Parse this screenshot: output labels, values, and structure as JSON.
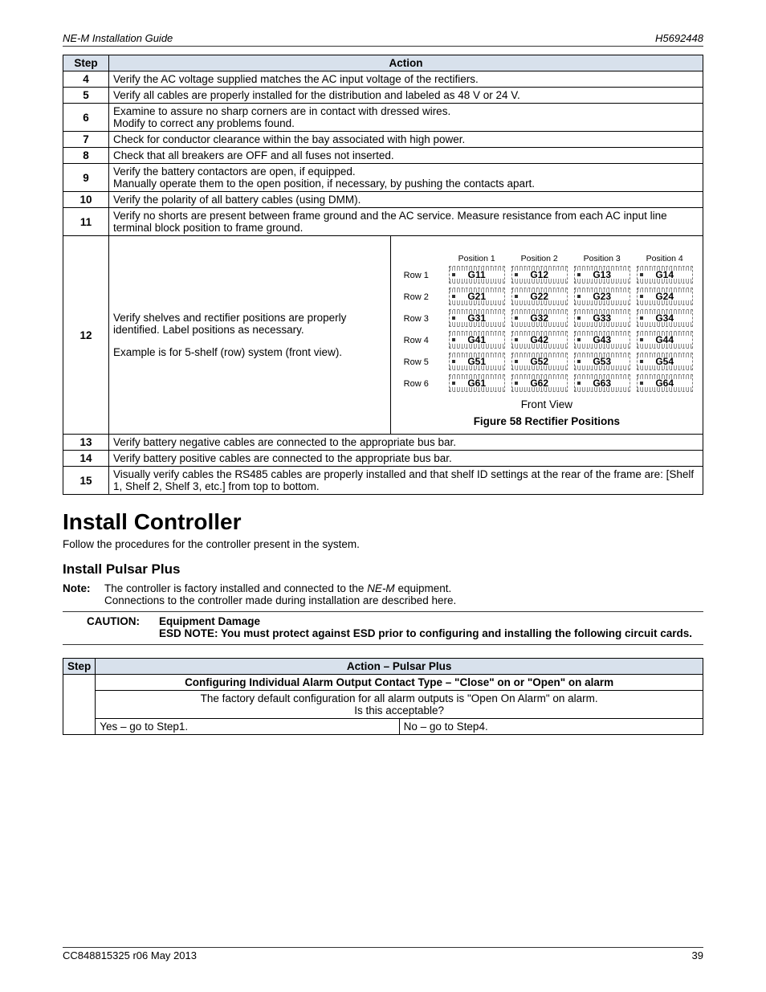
{
  "header": {
    "left": "NE-M Installation Guide",
    "right": "H5692448"
  },
  "footer": {
    "left": "CC848815325  r06  May 2013",
    "right": "39"
  },
  "table1": {
    "headers": {
      "step": "Step",
      "action": "Action"
    },
    "rows": [
      {
        "step": "4",
        "action": "Verify the AC voltage supplied matches the AC input voltage of the rectifiers."
      },
      {
        "step": "5",
        "action": "Verify all cables are properly installed for the distribution and labeled as 48 V or 24 V."
      },
      {
        "step": "6",
        "action": "Examine to assure no sharp corners are in contact with dressed wires.\nModify to correct any problems found."
      },
      {
        "step": "7",
        "action": "Check for conductor clearance within the bay associated with high power."
      },
      {
        "step": "8",
        "action": "Check that all breakers are OFF and all fuses not inserted."
      },
      {
        "step": "9",
        "action": "Verify the battery contactors are open, if equipped.\nManually operate them to the open position, if necessary, by pushing the contacts apart."
      },
      {
        "step": "10",
        "action": "Verify the polarity of all battery cables (using DMM)."
      },
      {
        "step": "11",
        "action": "Verify no shorts are present between frame ground and the AC service. Measure resistance from each AC input line terminal block position to frame ground."
      },
      {
        "step": "12",
        "action_left": "Verify shelves and rectifier positions are properly identified. Label positions as necessary.\n\nExample is for 5-shelf (row) system (front view).",
        "fig": {
          "positions": [
            "Position 1",
            "Position 2",
            "Position 3",
            "Position 4"
          ],
          "rows": [
            {
              "label": "Row 1",
              "cells": [
                "G11",
                "G12",
                "G13",
                "G14"
              ]
            },
            {
              "label": "Row 2",
              "cells": [
                "G21",
                "G22",
                "G23",
                "G24"
              ]
            },
            {
              "label": "Row 3",
              "cells": [
                "G31",
                "G32",
                "G33",
                "G34"
              ]
            },
            {
              "label": "Row 4",
              "cells": [
                "G41",
                "G42",
                "G43",
                "G44"
              ]
            },
            {
              "label": "Row 5",
              "cells": [
                "G51",
                "G52",
                "G53",
                "G54"
              ]
            },
            {
              "label": "Row 6",
              "cells": [
                "G61",
                "G62",
                "G63",
                "G64"
              ]
            }
          ],
          "caption": "Front View",
          "title": "Figure 58 Rectifier Positions"
        }
      },
      {
        "step": "13",
        "action": "Verify battery negative cables are connected to the appropriate bus bar."
      },
      {
        "step": "14",
        "action": "Verify battery positive cables are connected to the appropriate bus bar."
      },
      {
        "step": "15",
        "action": "Visually verify cables the RS485 cables are properly installed and that shelf ID settings at the rear of the frame are: [Shelf 1, Shelf 2, Shelf 3, etc.] from top to bottom."
      }
    ]
  },
  "section": {
    "title": "Install Controller",
    "lead": "Follow the procedures for the controller present in the system.",
    "sub": "Install Pulsar Plus",
    "note_label": "Note:",
    "note_lines": [
      {
        "pre": "The controller is factory installed and connected to the ",
        "ital": "NE-M",
        "post": " equipment."
      },
      {
        "text": "Connections to the controller made during installation are described here."
      }
    ],
    "caution": {
      "label": "CAUTION:",
      "title": "Equipment Damage",
      "body": "ESD NOTE:  You must protect against ESD prior to configuring and installing the following circuit cards."
    }
  },
  "table2": {
    "headers": {
      "step": "Step",
      "action": "Action – Pulsar Plus"
    },
    "config_title": "Configuring Individual Alarm Output Contact Type – \"Close\" on or \"Open\" on alarm",
    "config_body1": "The factory default configuration for all alarm outputs is \"Open On Alarm\" on alarm.",
    "config_body2": "Is this acceptable?",
    "yes": "Yes – go to Step1.",
    "no": "No – go to Step4."
  }
}
